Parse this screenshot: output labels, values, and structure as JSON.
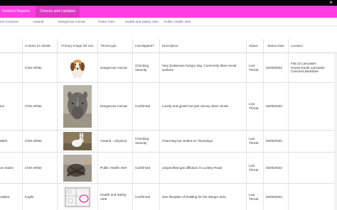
{
  "window": {
    "close_glyph": "×"
  },
  "nav": {
    "items": [
      {
        "label": "Incident Reports"
      },
      {
        "label": "Checks and Updates",
        "active": true
      }
    ]
  },
  "subnav": {
    "items": [
      "ent Contacts",
      "Assault",
      "Dangerous Animal",
      "Police Alert",
      "Health and Safety Alert",
      "Public Health Alert"
    ]
  },
  "table": {
    "headers": {
      "contact": "Contact for details",
      "image": "Primary image full size",
      "threat": "Threat type",
      "investigated": "Investigated?",
      "description": "Description",
      "status": "Status",
      "status_date": "Status Date",
      "location": "Location"
    },
    "rows": [
      {
        "name": "",
        "contact": "Chris White",
        "image_icon": "beagle-dog-image",
        "threat": "Dangerous Animal",
        "investigated": "Checking Veracity",
        "description": "Very boisterous hungry dog. Commonly bites social workers",
        "status": "Live Threat",
        "status_date": "02/05/2022",
        "location": "Flat 22 Lancaster House,South Lancaster Crescent,Berkshire"
      },
      {
        "name": "ino",
        "contact": "Chris White",
        "image_icon": "rhino-image",
        "threat": "Dangerous Animal",
        "investigated": "Confirmed",
        "description": "Lovely and gentle but just clumsy when drunk.",
        "status": "Live Threat",
        "status_date": "02/05/2022",
        "location": ""
      },
      {
        "name": "abbit",
        "contact": "Chris White",
        "image_icon": "rabbit-image",
        "threat": "Assault – physical",
        "investigated": "Checking Veracity",
        "description": "Charming but violent on Thursdays",
        "status": "Live Threat",
        "status_date": "02/05/2022",
        "location": ""
      },
      {
        "name": "on drains",
        "contact": "Chris White",
        "image_icon": "drain-image",
        "threat": "Public Health Alert",
        "investigated": "Confirmed",
        "description": "unspecified gas diffusion in Luckley Road",
        "status": "Live Threat",
        "status_date": "02/05/2022",
        "location": ""
      },
      {
        "name": "cables",
        "contact": "Kaylie",
        "image_icon": "floorplan-image",
        "threat": "Health and Safety Alert",
        "investigated": "Confirmed",
        "description": "See floorplan of building for the danger area",
        "status": "Live Threat",
        "status_date": "02/05/2022",
        "location": ""
      }
    ]
  }
}
